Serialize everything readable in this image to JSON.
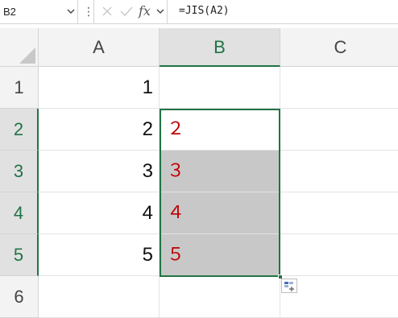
{
  "formula_bar": {
    "name_box": "B2",
    "fx_label": "fx",
    "formula": "=JIS(A2)"
  },
  "columns": [
    "A",
    "B",
    "C"
  ],
  "rows": [
    "1",
    "2",
    "3",
    "4",
    "5",
    "6"
  ],
  "cells": {
    "A1": "1",
    "A2": "2",
    "A3": "3",
    "A4": "4",
    "A5": "5",
    "B2": "２",
    "B3": "３",
    "B4": "４",
    "B5": "５"
  },
  "colors": {
    "selection_green": "#217346",
    "jis_text_red": "#c00000",
    "highlight_gray": "#c8c8c8"
  },
  "icons": [
    "chevron-down-icon",
    "more-options-icon",
    "cancel-icon",
    "enter-icon",
    "insert-function-icon",
    "quick-analysis-icon"
  ]
}
